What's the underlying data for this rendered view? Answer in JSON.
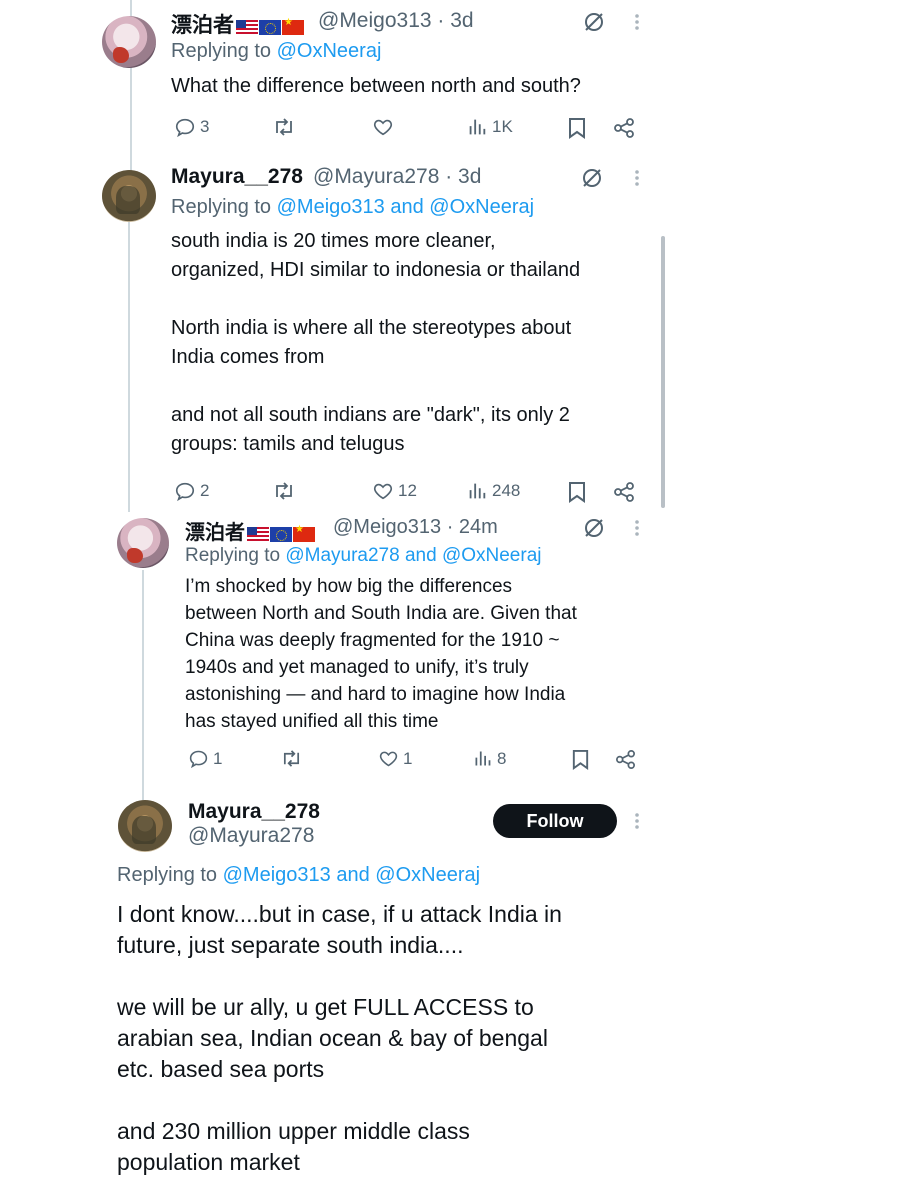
{
  "tweets": [
    {
      "display_name": "漂泊者",
      "handle_time": "@Meigo313 · 3d",
      "replying_prefix": "Replying to ",
      "mentions": "@OxNeeraj",
      "mentions_join": "",
      "mentions_2": "",
      "text": "What the difference between north and south?",
      "replies": "3",
      "retweets": "",
      "likes": "",
      "views": "1K"
    },
    {
      "display_name": "Mayura__278",
      "handle_time": "@Mayura278 · 3d",
      "replying_prefix": "Replying to ",
      "mentions": "@Meigo313",
      "mentions_join": " and ",
      "mentions_2": "@OxNeeraj",
      "text": "south india is 20 times more cleaner,\norganized, HDI similar to indonesia or thailand\n\nNorth india is where all the stereotypes about\nIndia comes from\n\nand not all south indians are \"dark\", its only 2\ngroups: tamils and telugus",
      "replies": "2",
      "retweets": "",
      "likes": "12",
      "views": "248"
    },
    {
      "display_name": "漂泊者",
      "handle_time": "@Meigo313 · 24m",
      "replying_prefix": "Replying to ",
      "mentions": "@Mayura278",
      "mentions_join": " and ",
      "mentions_2": "@OxNeeraj",
      "text": "I’m shocked by how big the differences\nbetween North and South India are. Given that\nChina was deeply fragmented for the 1910 ~\n1940s and yet managed to unify, it’s truly\nastonishing — and hard to imagine how India\nhas stayed unified all this time",
      "replies": "1",
      "retweets": "",
      "likes": "1",
      "views": "8"
    }
  ],
  "focused": {
    "display_name": "Mayura__278",
    "handle": "@Mayura278",
    "follow_label": "Follow",
    "replying_prefix": "Replying to ",
    "mention_1": "@Meigo313",
    "mentions_join": " and ",
    "mention_2": "@OxNeeraj",
    "text": "I dont know....but in case, if u attack India in\nfuture, just separate south india....\n\nwe will be ur ally, u get FULL ACCESS to\narabian sea, Indian ocean & bay of bengal\netc. based sea ports\n\nand 230 million upper middle class\npopulation market"
  },
  "colors": {
    "accent": "#1d9bf0",
    "secondary_text": "#536471",
    "follow_bg": "#0f1419"
  },
  "icons": [
    "reply-icon",
    "retweet-icon",
    "like-icon",
    "views-icon",
    "bookmark-icon",
    "share-icon",
    "grok-icon",
    "more-icon",
    "flag-us-icon",
    "flag-eu-icon",
    "flag-cn-icon"
  ]
}
